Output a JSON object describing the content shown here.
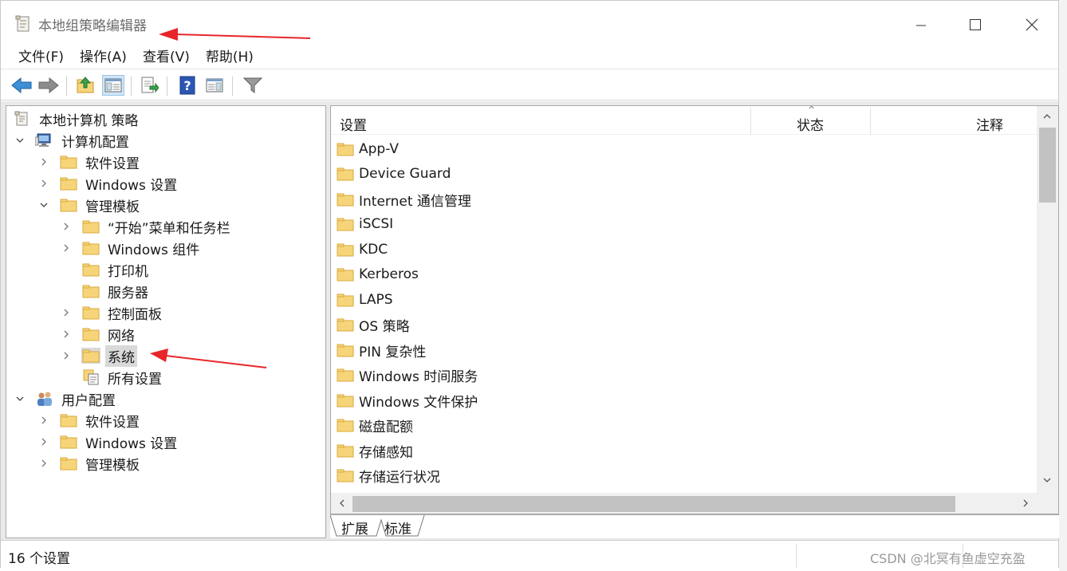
{
  "window": {
    "title": "本地组策略编辑器",
    "controls": [
      "minimize",
      "maximize",
      "close"
    ]
  },
  "menu": [
    {
      "label": "文件(F)"
    },
    {
      "label": "操作(A)"
    },
    {
      "label": "查看(V)"
    },
    {
      "label": "帮助(H)"
    }
  ],
  "toolbar": {
    "buttons": [
      {
        "icon": "back-arrow-icon"
      },
      {
        "icon": "forward-arrow-icon"
      },
      {
        "icon": "up-folder-icon"
      },
      {
        "icon": "show-hide-tree-icon",
        "active": true
      },
      {
        "icon": "export-list-icon"
      },
      {
        "icon": "help-icon"
      },
      {
        "icon": "properties-pane-icon"
      },
      {
        "icon": "filter-icon"
      }
    ]
  },
  "tree": {
    "items": [
      {
        "label": "本地计算机 策略",
        "level": 0,
        "icon": "policy-scroll-icon",
        "expander": "none"
      },
      {
        "label": "计算机配置",
        "level": 0,
        "icon": "computer-icon",
        "expander": "expanded"
      },
      {
        "label": "软件设置",
        "level": 1,
        "icon": "folder-icon",
        "expander": "collapsed"
      },
      {
        "label": "Windows 设置",
        "level": 1,
        "icon": "folder-icon",
        "expander": "collapsed"
      },
      {
        "label": "管理模板",
        "level": 1,
        "icon": "folder-icon",
        "expander": "expanded"
      },
      {
        "label": "“开始”菜单和任务栏",
        "level": 2,
        "icon": "folder-icon",
        "expander": "collapsed"
      },
      {
        "label": "Windows 组件",
        "level": 2,
        "icon": "folder-icon",
        "expander": "collapsed"
      },
      {
        "label": "打印机",
        "level": 2,
        "icon": "folder-icon",
        "expander": "none"
      },
      {
        "label": "服务器",
        "level": 2,
        "icon": "folder-icon",
        "expander": "none"
      },
      {
        "label": "控制面板",
        "level": 2,
        "icon": "folder-icon",
        "expander": "collapsed"
      },
      {
        "label": "网络",
        "level": 2,
        "icon": "folder-icon",
        "expander": "collapsed"
      },
      {
        "label": "系统",
        "level": 2,
        "icon": "folder-icon",
        "expander": "collapsed",
        "selected": true
      },
      {
        "label": "所有设置",
        "level": 2,
        "icon": "all-settings-icon",
        "expander": "none"
      },
      {
        "label": "用户配置",
        "level": 0,
        "icon": "users-icon",
        "expander": "expanded"
      },
      {
        "label": "软件设置",
        "level": 1,
        "icon": "folder-icon",
        "expander": "collapsed"
      },
      {
        "label": "Windows 设置",
        "level": 1,
        "icon": "folder-icon",
        "expander": "collapsed"
      },
      {
        "label": "管理模板",
        "level": 1,
        "icon": "folder-icon",
        "expander": "collapsed"
      }
    ]
  },
  "list": {
    "columns": [
      {
        "label": "设置"
      },
      {
        "label": "状态"
      },
      {
        "label": "注释"
      }
    ],
    "rows": [
      {
        "label": "App-V"
      },
      {
        "label": "Device Guard"
      },
      {
        "label": "Internet 通信管理"
      },
      {
        "label": "iSCSI"
      },
      {
        "label": "KDC"
      },
      {
        "label": "Kerberos"
      },
      {
        "label": "LAPS"
      },
      {
        "label": "OS 策略"
      },
      {
        "label": "PIN 复杂性"
      },
      {
        "label": "Windows 时间服务"
      },
      {
        "label": "Windows 文件保护"
      },
      {
        "label": "磁盘配额"
      },
      {
        "label": "存储感知"
      },
      {
        "label": "存储运行状况"
      }
    ]
  },
  "tabs": [
    {
      "label": "扩展",
      "active": false
    },
    {
      "label": "标准",
      "active": true
    }
  ],
  "status": {
    "text": "16 个设置"
  },
  "watermark": "CSDN @北冥有鱼虚空充盈",
  "colors": {
    "folder": "#f6d57a",
    "folder_edge": "#d9a93a",
    "selection": "#d9d9d9",
    "annotation_arrow": "#e8262a",
    "toolbar_active": "#cfe5f7"
  }
}
